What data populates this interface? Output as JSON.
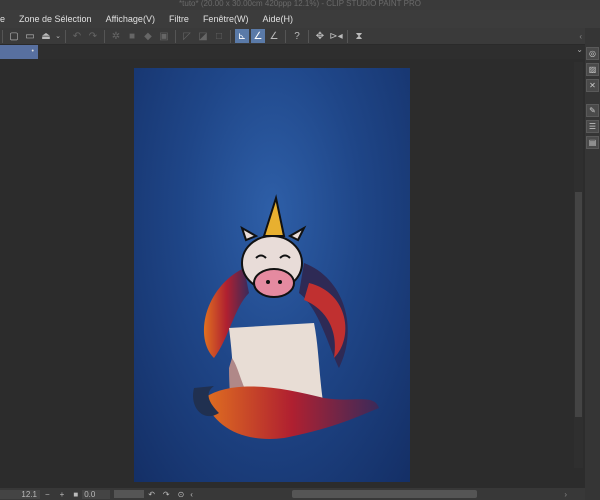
{
  "title": "*tuto* (20.00 x 30.00cm 420ppp 12.1%) - CLIP STUDIO PAINT PRO",
  "menu": [
    "e",
    "Zone de Sélection",
    "Affichage(V)",
    "Filtre",
    "Fenêtre(W)",
    "Aide(H)"
  ],
  "status": {
    "zoom": "12.1",
    "minus": "−",
    "plus": "+",
    "angle": "0.0"
  },
  "tab": {
    "close": "•"
  }
}
